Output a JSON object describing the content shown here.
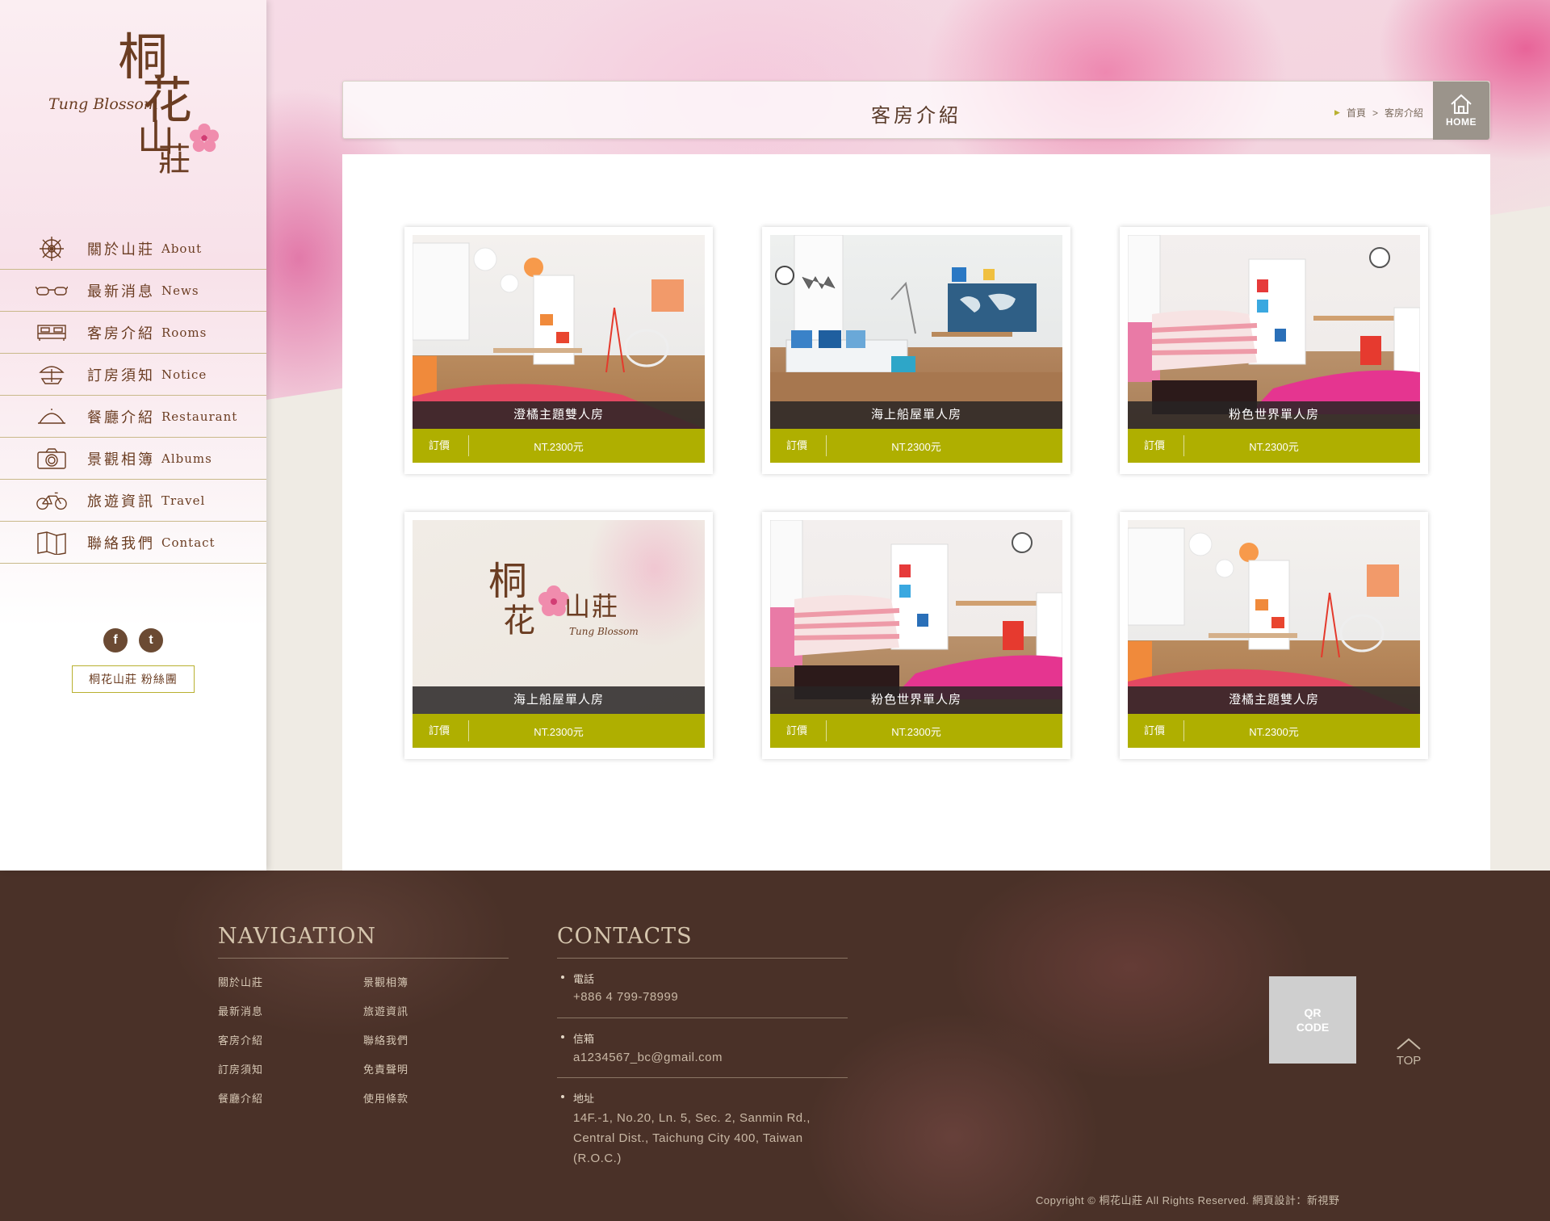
{
  "brand": {
    "name_chars": [
      "桐",
      "花",
      "山",
      "莊"
    ],
    "name_en": "Tung Blossom"
  },
  "nav": [
    {
      "zh": "關於山莊",
      "en": "About",
      "icon": "ship-wheel-icon"
    },
    {
      "zh": "最新消息",
      "en": "News",
      "icon": "glasses-icon"
    },
    {
      "zh": "客房介紹",
      "en": "Rooms",
      "icon": "bed-icon"
    },
    {
      "zh": "訂房須知",
      "en": "Notice",
      "icon": "beach-umbrella-icon"
    },
    {
      "zh": "餐廳介紹",
      "en": "Restaurant",
      "icon": "dish-cover-icon"
    },
    {
      "zh": "景觀相簿",
      "en": "Albums",
      "icon": "camera-icon"
    },
    {
      "zh": "旅遊資訊",
      "en": "Travel",
      "icon": "bicycle-icon"
    },
    {
      "zh": "聯絡我們",
      "en": "Contact",
      "icon": "map-icon"
    }
  ],
  "social": {
    "facebook": "f",
    "twitter": "t"
  },
  "fans_label": "桐花山莊 粉絲團",
  "page": {
    "title": "客房介紹",
    "breadcrumb": [
      "首頁",
      ">",
      "客房介紹"
    ],
    "home_label": "HOME"
  },
  "rooms": [
    {
      "name": "澄橘主題雙人房",
      "price_label": "訂價",
      "price": "NT.2300元",
      "scene": "orange"
    },
    {
      "name": "海上船屋單人房",
      "price_label": "訂價",
      "price": "NT.2300元",
      "scene": "blue"
    },
    {
      "name": "粉色世界單人房",
      "price_label": "訂價",
      "price": "NT.2300元",
      "scene": "pink"
    },
    {
      "name": "海上船屋單人房",
      "price_label": "訂價",
      "price": "NT.2300元",
      "scene": "logo"
    },
    {
      "name": "粉色世界單人房",
      "price_label": "訂價",
      "price": "NT.2300元",
      "scene": "pink"
    },
    {
      "name": "澄橘主題雙人房",
      "price_label": "訂價",
      "price": "NT.2300元",
      "scene": "orange"
    }
  ],
  "footer": {
    "nav_heading": "NAVIGATION",
    "nav_links_col1": [
      "關於山莊",
      "最新消息",
      "客房介紹",
      "訂房須知",
      "餐廳介紹"
    ],
    "nav_links_col2": [
      "景觀相簿",
      "旅遊資訊",
      "聯絡我們",
      "免責聲明",
      "使用條款"
    ],
    "contacts_heading": "CONTACTS",
    "phone_label": "電話",
    "phone": "+886 4 799-78999",
    "email_label": "信箱",
    "email": "a1234567_bc@gmail.com",
    "address_label": "地址",
    "address_lines": [
      "14F.-1, No.20, Ln. 5, Sec. 2, Sanmin Rd.,",
      "Central Dist., Taichung City 400, Taiwan",
      "(R.O.C.)"
    ],
    "qr_lines": [
      "QR",
      "CODE"
    ],
    "top_label": "TOP",
    "copyright": "Copyright © 桐花山莊 All Rights Reserved.    網頁設計：新視野"
  },
  "colors": {
    "accent": "#afaf00",
    "brown": "#6b3d22",
    "footer_bg": "#4a3128"
  }
}
